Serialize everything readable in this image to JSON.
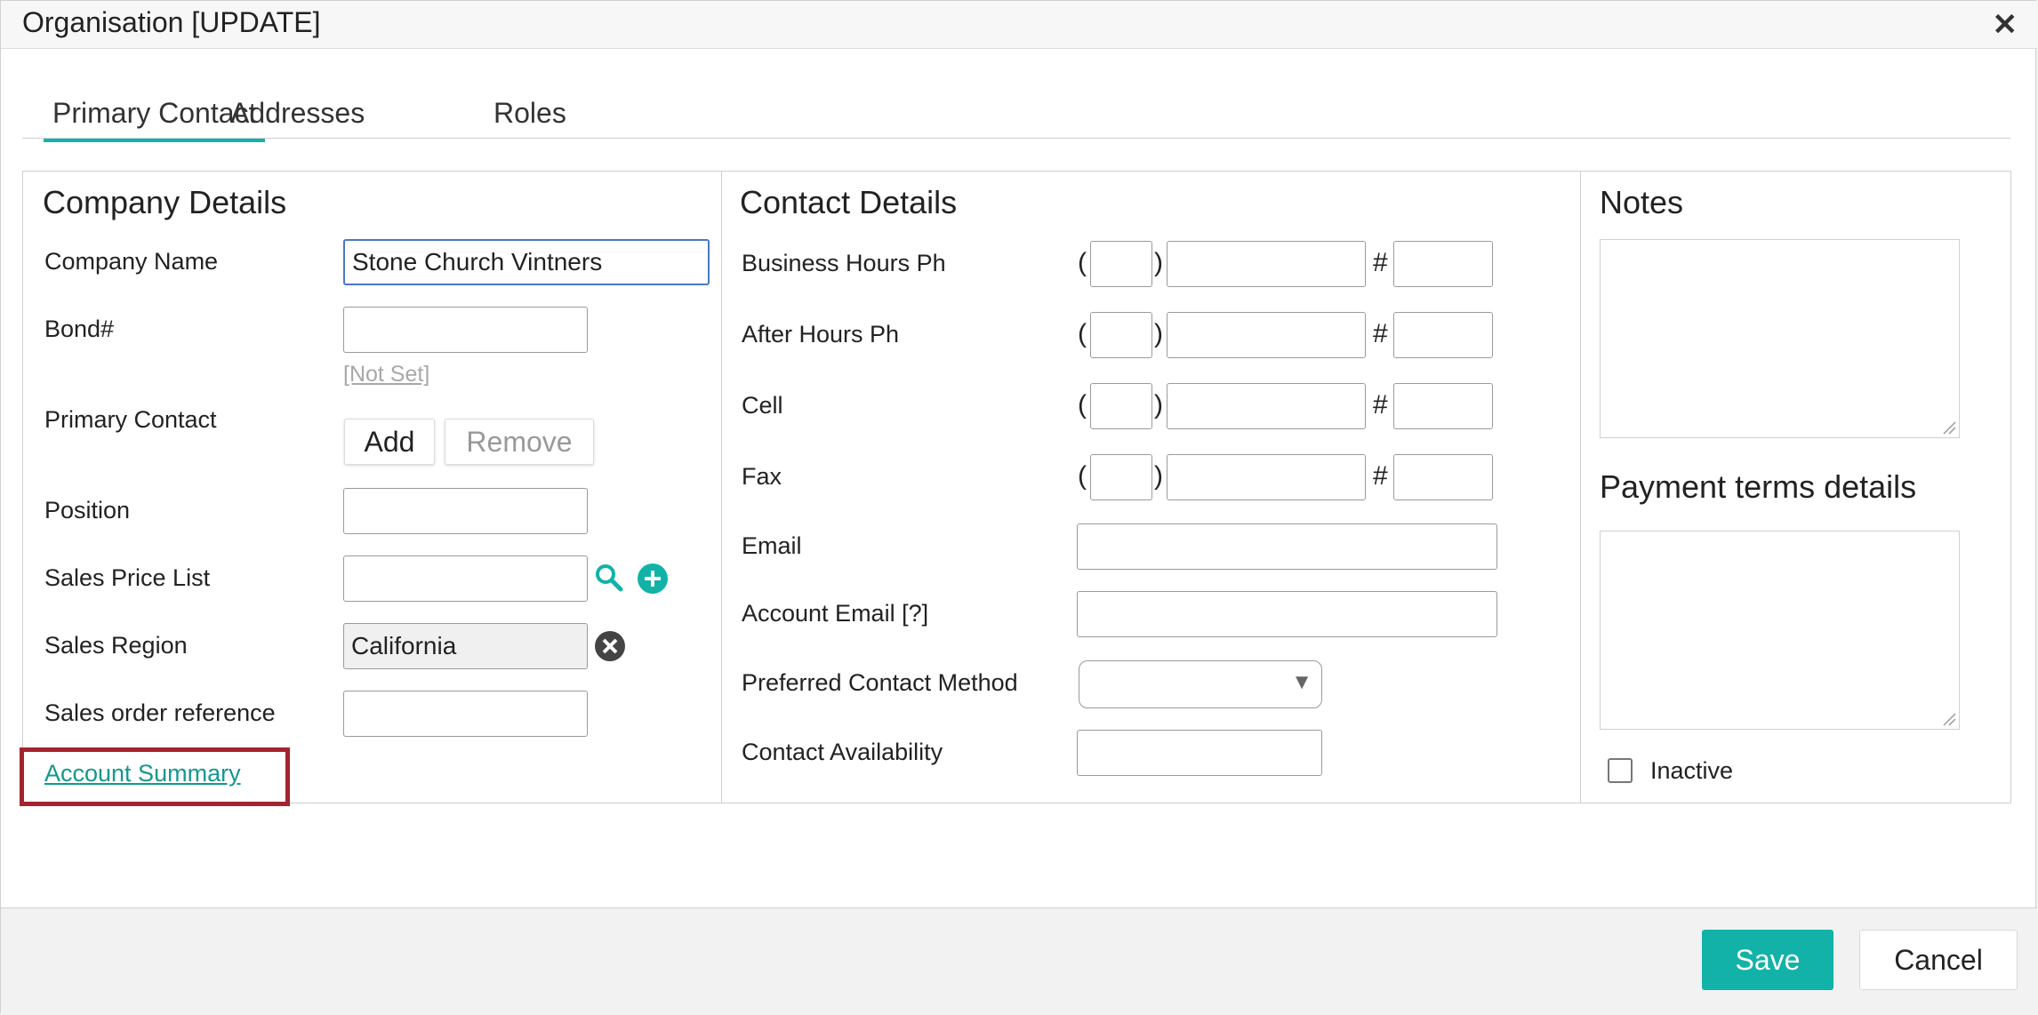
{
  "dialog": {
    "title": "Organisation [UPDATE]",
    "close_icon": "close-icon"
  },
  "tabs": [
    {
      "label": "Primary Contact",
      "active": true
    },
    {
      "label": "Addresses",
      "active": false
    },
    {
      "label": "Roles",
      "active": false
    }
  ],
  "company": {
    "heading": "Company Details",
    "company_name_label": "Company Name",
    "company_name_value": "Stone Church Vintners",
    "bond_label": "Bond#",
    "bond_value": "",
    "primary_contact_label": "Primary Contact",
    "primary_contact_value": "[Not Set]",
    "add_label": "Add",
    "remove_label": "Remove",
    "position_label": "Position",
    "position_value": "",
    "price_list_label": "Sales Price List",
    "price_list_value": "",
    "region_label": "Sales Region",
    "region_value": "California",
    "order_ref_label": "Sales order reference",
    "order_ref_value": "",
    "account_summary_link": "Account Summary"
  },
  "contact": {
    "heading": "Contact Details",
    "business_ph_label": "Business Hours Ph",
    "after_ph_label": "After Hours Ph",
    "cell_label": "Cell",
    "fax_label": "Fax",
    "open_paren": "(",
    "close_paren": ")",
    "hash": "#",
    "email_label": "Email",
    "email_value": "",
    "account_email_label": "Account Email [?]",
    "account_email_value": "",
    "preferred_method_label": "Preferred Contact Method",
    "preferred_method_value": "",
    "availability_label": "Contact Availability",
    "availability_value": ""
  },
  "notes": {
    "heading": "Notes",
    "payment_heading": "Payment terms details",
    "inactive_label": "Inactive",
    "inactive_checked": false
  },
  "footer": {
    "save_label": "Save",
    "cancel_label": "Cancel"
  },
  "colors": {
    "accent": "#13b2a8",
    "link": "#13998f",
    "highlight": "#a3232e"
  }
}
